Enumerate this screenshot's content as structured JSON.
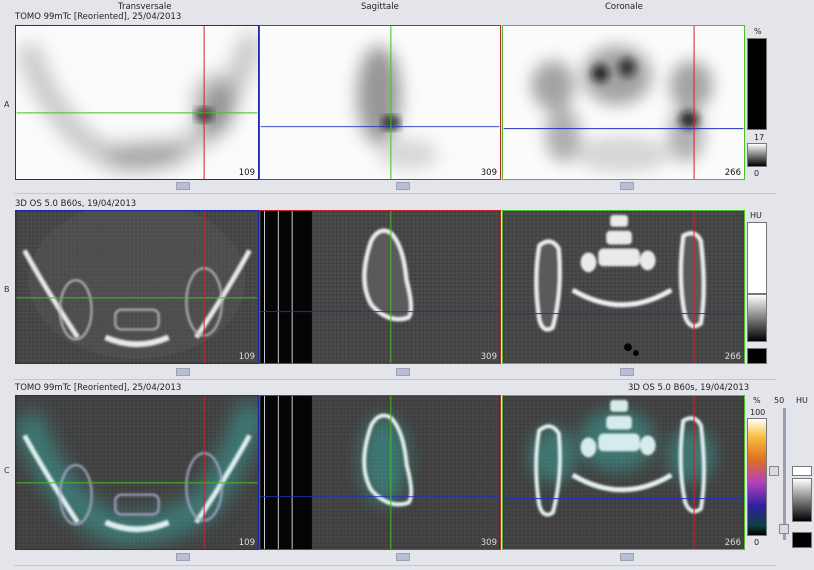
{
  "columns": {
    "transverse": "Transversale",
    "sagittal": "Sagittale",
    "coronal": "Coronale"
  },
  "rows": {
    "a": {
      "label": "A",
      "title": "TOMO 99mTc [Reoriented], 25/04/2013",
      "scale_unit": "%",
      "scale_top": "17",
      "scale_bottom": "0"
    },
    "b": {
      "label": "B",
      "title": "3D  OS  5.0  B60s, 19/04/2013",
      "scale_unit": "HU"
    },
    "c": {
      "label": "C",
      "title_left": "TOMO 99mTc [Reoriented], 25/04/2013",
      "title_right": "3D  OS  5.0  B60s, 19/04/2013",
      "scale_unit": "%",
      "scale_top": "100",
      "scale_bottom": "0",
      "fusion_value": "50",
      "ct_unit": "HU"
    }
  },
  "slices": {
    "transverse": "109",
    "sagittal": "309",
    "coronal": "266"
  },
  "colors": {
    "transverse_border": "#1a2aa6",
    "sagittal_border": "#c0262a",
    "coronal_border": "#4fbf2c",
    "crosshair_red": "#d0202a",
    "crosshair_green": "#40c020",
    "crosshair_blue": "#2030c0"
  }
}
